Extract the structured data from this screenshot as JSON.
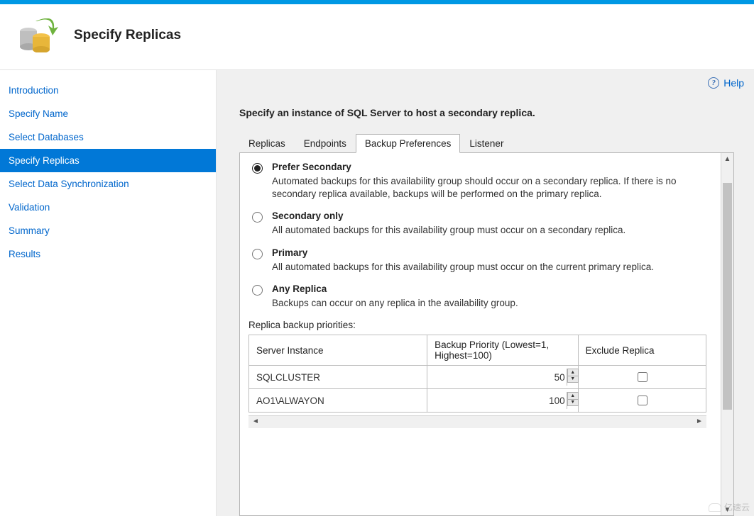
{
  "header": {
    "title": "Specify Replicas"
  },
  "help": {
    "label": "Help"
  },
  "sidebar": {
    "items": [
      {
        "label": "Introduction"
      },
      {
        "label": "Specify Name"
      },
      {
        "label": "Select Databases"
      },
      {
        "label": "Specify Replicas"
      },
      {
        "label": "Select Data Synchronization"
      },
      {
        "label": "Validation"
      },
      {
        "label": "Summary"
      },
      {
        "label": "Results"
      }
    ],
    "active_index": 3
  },
  "main": {
    "instruction": "Specify an instance of SQL Server to host a secondary replica.",
    "tabs": [
      {
        "label": "Replicas"
      },
      {
        "label": "Endpoints"
      },
      {
        "label": "Backup Preferences"
      },
      {
        "label": "Listener"
      }
    ],
    "active_tab_index": 2,
    "backup_prefs": {
      "options": [
        {
          "title": "Prefer Secondary",
          "desc": "Automated backups for this availability group should occur on a secondary replica. If there is no secondary replica available, backups will be performed on the primary replica.",
          "selected": true
        },
        {
          "title": "Secondary only",
          "desc": "All automated backups for this availability group must occur on a secondary replica.",
          "selected": false
        },
        {
          "title": "Primary",
          "desc": "All automated backups for this availability group must occur on the current primary replica.",
          "selected": false
        },
        {
          "title": "Any Replica",
          "desc": "Backups can occur on any replica in the availability group.",
          "selected": false
        }
      ],
      "priorities_label": "Replica backup priorities:",
      "columns": {
        "server": "Server Instance",
        "priority": "Backup Priority (Lowest=1, Highest=100)",
        "exclude": "Exclude Replica"
      },
      "rows": [
        {
          "server": "SQLCLUSTER",
          "priority": "50",
          "exclude": false
        },
        {
          "server": "AO1\\ALWAYON",
          "priority": "100",
          "exclude": false
        }
      ]
    }
  },
  "watermark": "亿速云"
}
